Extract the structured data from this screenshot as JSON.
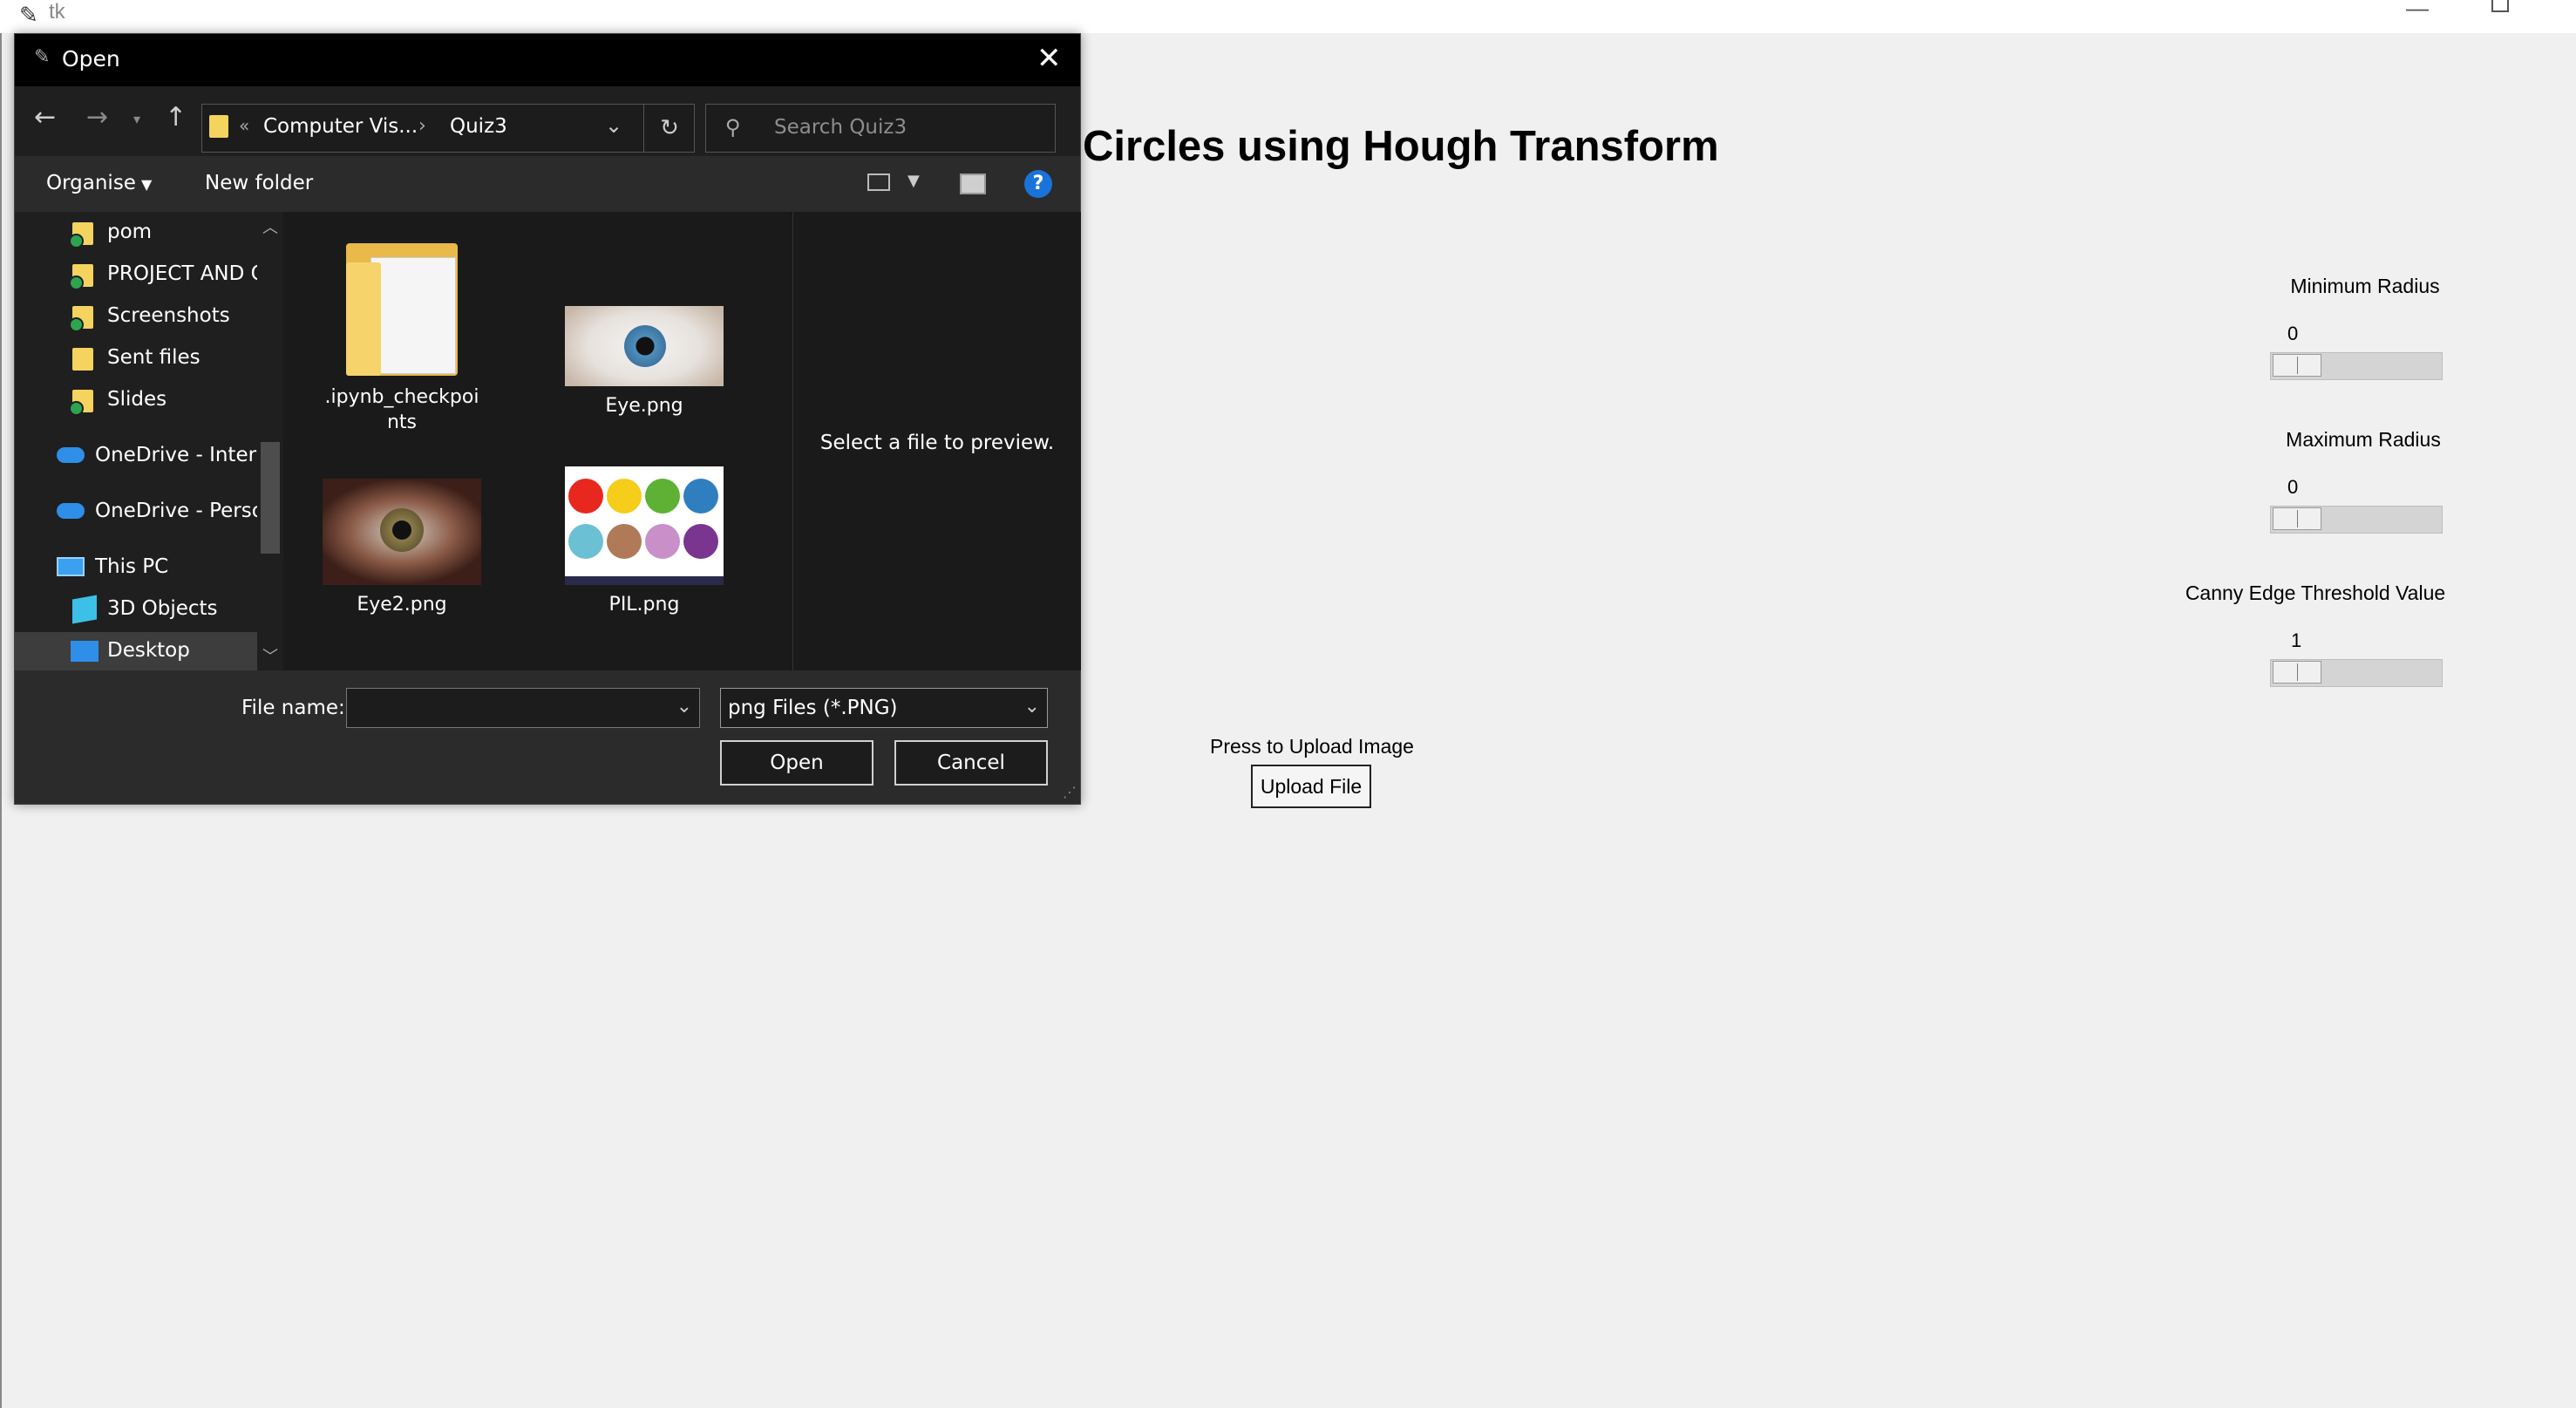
{
  "tk_window": {
    "title": "tk",
    "heading": "Circles using Hough Transform",
    "sliders": [
      {
        "label": "Minimum Radius",
        "value": "0"
      },
      {
        "label": "Maximum Radius",
        "value": "0"
      },
      {
        "label": "Canny Edge Threshold Value",
        "value": "1"
      }
    ],
    "upload": {
      "label": "Press to Upload Image",
      "button": "Upload File"
    }
  },
  "dialog": {
    "title": "Open",
    "address": {
      "overflow": "«",
      "seg1": "Computer Vis...",
      "separator": "›",
      "seg2": "Quiz3"
    },
    "search_placeholder": "Search Quiz3",
    "commands": {
      "organise": "Organise",
      "new_folder": "New folder"
    },
    "nav_items": [
      {
        "label": "pom"
      },
      {
        "label": "PROJECT AND O"
      },
      {
        "label": "Screenshots"
      },
      {
        "label": "Sent files"
      },
      {
        "label": "Slides"
      },
      {
        "label": "OneDrive - Interna"
      },
      {
        "label": "OneDrive - Persor"
      },
      {
        "label": "This PC"
      },
      {
        "label": "3D Objects"
      },
      {
        "label": "Desktop"
      }
    ],
    "files": [
      {
        "name_line1": ".ipynb_checkpoi",
        "name_line2": "nts",
        "kind": "folder"
      },
      {
        "name": "Eye.png",
        "kind": "image"
      },
      {
        "name": "Eye2.png",
        "kind": "image"
      },
      {
        "name": "PIL.png",
        "kind": "image"
      }
    ],
    "pil_colors": [
      "#e8281f",
      "#f5cd1a",
      "#5db235",
      "#2f7fc0",
      "#6cc0d4",
      "#b07a58",
      "#c98fc9",
      "#7a3590"
    ],
    "preview_text": "Select a file to preview.",
    "file_name_label": "File name:",
    "file_name_value": "",
    "file_type": "png Files (*.PNG)",
    "open_button": "Open",
    "cancel_button": "Cancel"
  }
}
